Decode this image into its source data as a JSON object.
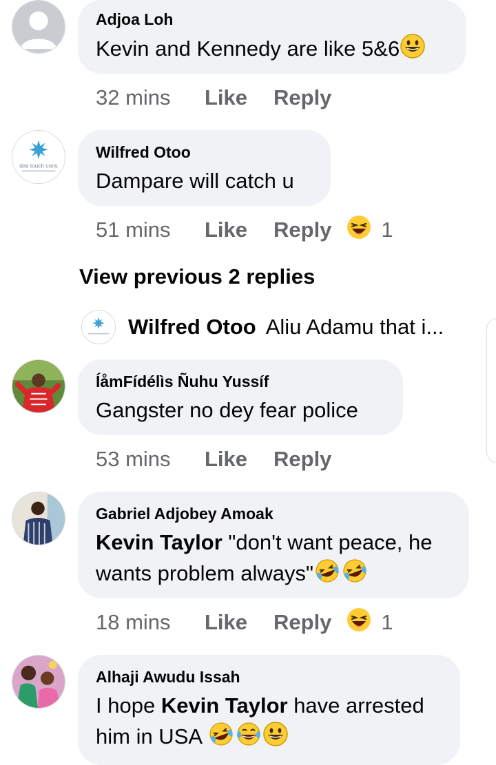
{
  "comments": [
    {
      "name": "Adjoa Loh",
      "text": "Kevin and Kennedy are like 5&6",
      "time": "32 mins",
      "like": "Like",
      "reply": "Reply"
    },
    {
      "name": "Wilfred Otoo",
      "text": "Dampare will catch u",
      "time": "51 mins",
      "like": "Like",
      "reply": "Reply",
      "reaction_count": "1",
      "avatar_text": "das touch cons"
    },
    {
      "name": "ÍåmFídélìs Ñuhu Yussíf",
      "text": "Gangster no dey fear police",
      "time": "53 mins",
      "like": "Like",
      "reply": "Reply"
    },
    {
      "name": "Gabriel Adjobey Amoak",
      "mention": "Kevin Taylor",
      "text_line1": " \"don't want peace, he",
      "text_line2": "wants problem always\"",
      "time": "18 mins",
      "like": "Like",
      "reply": "Reply",
      "reaction_count": "1"
    },
    {
      "name": "Alhaji Awudu Issah",
      "text_pre": "I hope ",
      "mention": "Kevin Taylor",
      "text_post": " have arrested",
      "text_line2": "him in USA"
    }
  ],
  "view_previous": "View previous 2 replies",
  "sub_reply": {
    "name": "Wilfred Otoo",
    "text": "Aliu Adamu that i..."
  },
  "colors": {
    "bubble": "#f0f2f5",
    "meta": "#65676b",
    "text": "#050505"
  }
}
